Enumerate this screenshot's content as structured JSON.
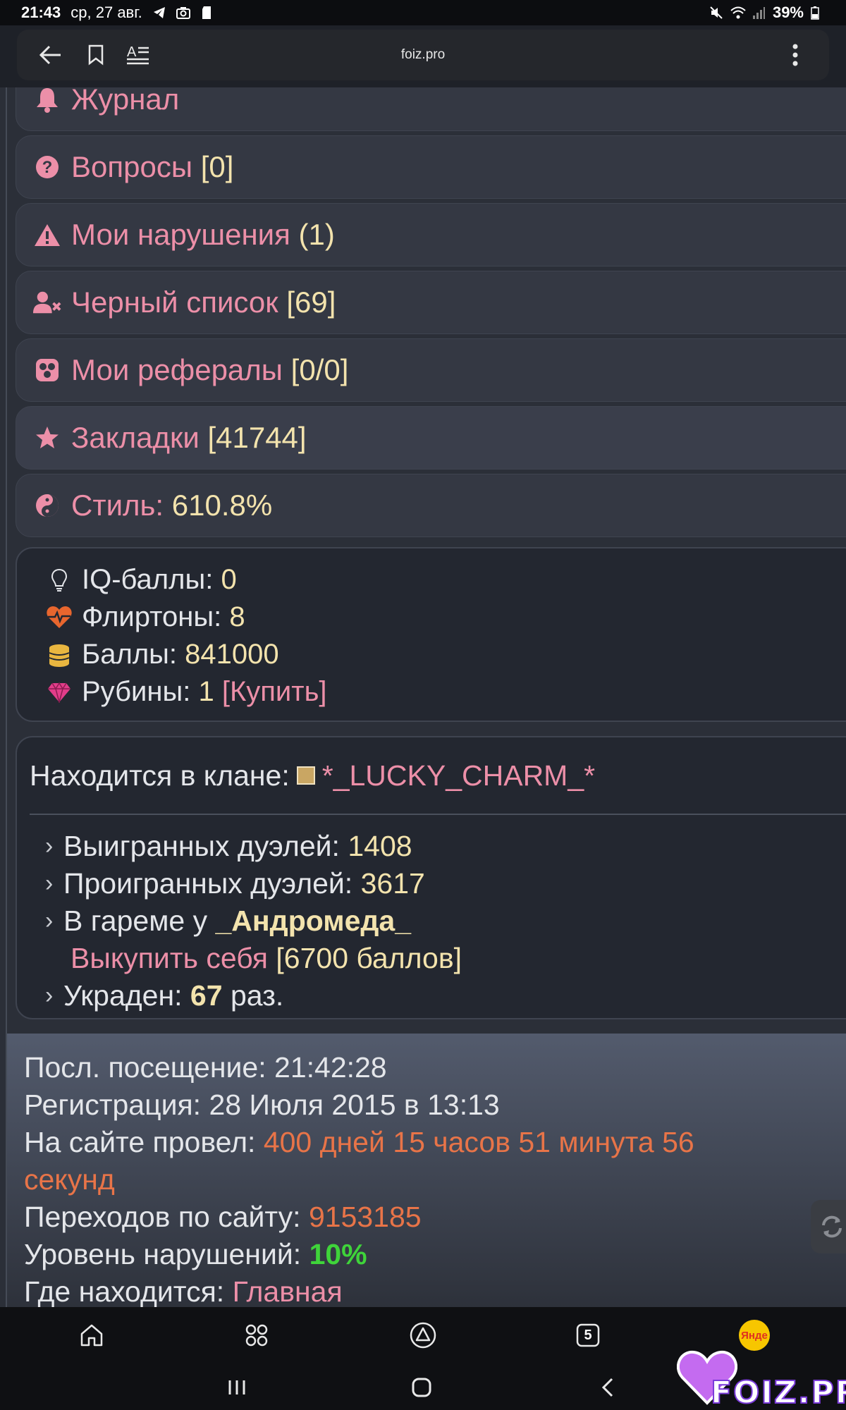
{
  "status_bar": {
    "time": "21:43",
    "date": "ср, 27 авг.",
    "battery": "39%"
  },
  "browser": {
    "url": "foiz.pro"
  },
  "menu": [
    {
      "label": "Журнал",
      "value": "",
      "icon": "bell-icon"
    },
    {
      "label": "Вопросы",
      "value": "[0]",
      "icon": "question-circle-icon"
    },
    {
      "label": "Мои нарушения",
      "value": "(1)",
      "icon": "warning-icon"
    },
    {
      "label": "Черный список",
      "value": "[69]",
      "icon": "user-block-icon"
    },
    {
      "label": "Мои рефералы",
      "value": "[0/0]",
      "icon": "referrals-icon"
    },
    {
      "label": "Закладки",
      "value": "[41744]",
      "icon": "star-icon"
    },
    {
      "label": "Стиль:",
      "value": "610.8%",
      "icon": "yin-yang-icon"
    }
  ],
  "stats": {
    "iq_label": "IQ-баллы:",
    "iq_value": "0",
    "flirt_label": "Флиртоны:",
    "flirt_value": "8",
    "points_label": "Баллы:",
    "points_value": "841000",
    "rubies_label": "Рубины:",
    "rubies_value": "1",
    "rubies_buy": "[Купить]"
  },
  "clan": {
    "label": "Находится в клане:",
    "name": "*_LUCKY_CHARM_*",
    "won_label": "Выигранных дуэлей:",
    "won_value": "1408",
    "lost_label": "Проигранных дуэлей:",
    "lost_value": "3617",
    "harem_label": "В гареме у",
    "harem_owner": "_Андромеда_",
    "buyout_link": "Выкупить себя",
    "buyout_cost": "[6700 баллов]",
    "stolen_label": "Украден:",
    "stolen_count": "67",
    "stolen_suffix": "раз."
  },
  "info": {
    "last_visit_label": "Посл. посещение:",
    "last_visit_value": "21:42:28",
    "registration_label": "Регистрация:",
    "registration_value": "28 Июля 2015 в 13:13",
    "time_on_site_label": "На сайте провел:",
    "time_on_site_value": "400 дней 15 часов 51 минута 56",
    "time_on_site_value2": "секунд",
    "transitions_label": "Переходов по сайту:",
    "transitions_value": "9153185",
    "violations_label": "Уровень нарушений:",
    "violations_value": "10%",
    "location_label": "Где находится:",
    "location_value": "Главная"
  },
  "bottom_nav": {
    "tabs_count": "5",
    "yandex_label": "Янде"
  },
  "watermark": {
    "text": "FOIZ.PRO"
  },
  "colors": {
    "pink": "#ec8fa8",
    "cream": "#f3e3ad",
    "orange": "#e87448",
    "green": "#3fd43a"
  }
}
